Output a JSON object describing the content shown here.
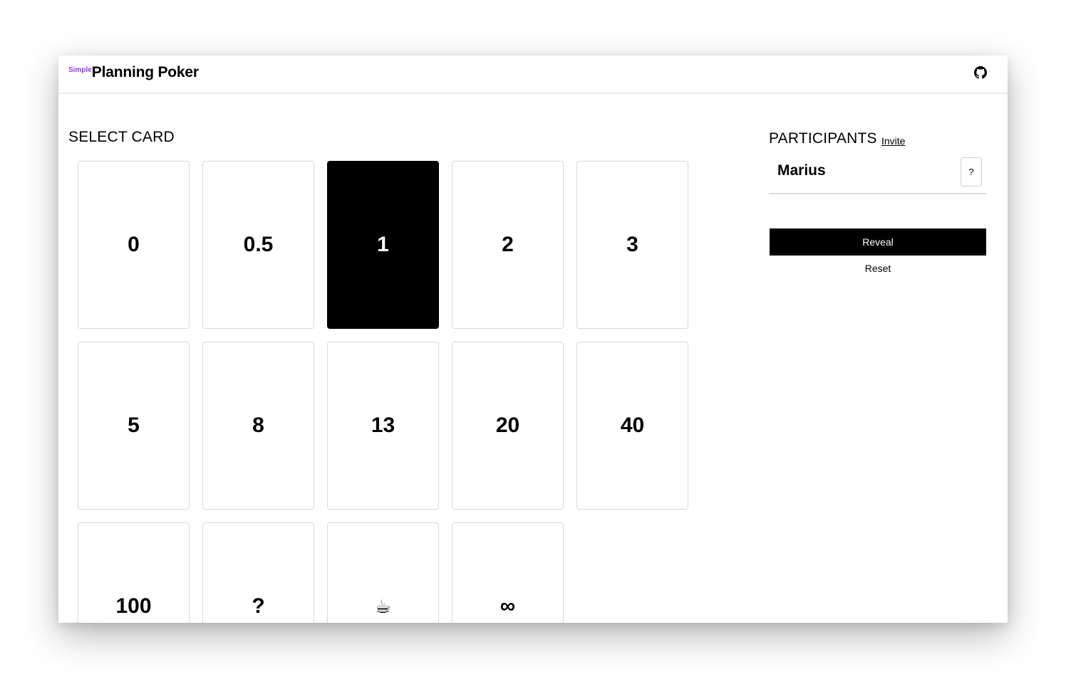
{
  "header": {
    "brand_prefix": "Simple",
    "brand_title": "Planning Poker",
    "github_icon": "github-icon"
  },
  "select_card": {
    "title": "SELECT CARD",
    "selected": "1",
    "cards": [
      {
        "value": "0"
      },
      {
        "value": "0.5"
      },
      {
        "value": "1"
      },
      {
        "value": "2"
      },
      {
        "value": "3"
      },
      {
        "value": "5"
      },
      {
        "value": "8"
      },
      {
        "value": "13"
      },
      {
        "value": "20"
      },
      {
        "value": "40"
      },
      {
        "value": "100"
      },
      {
        "value": "?"
      },
      {
        "value": "☕"
      },
      {
        "value": "∞"
      }
    ]
  },
  "participants": {
    "title": "PARTICIPANTS",
    "invite_label": "Invite",
    "list": [
      {
        "name": "Marius",
        "vote": "?"
      }
    ]
  },
  "actions": {
    "reveal_label": "Reveal",
    "reset_label": "Reset"
  },
  "colors": {
    "accent": "#8b3ff5",
    "selected_card": "#000000"
  }
}
